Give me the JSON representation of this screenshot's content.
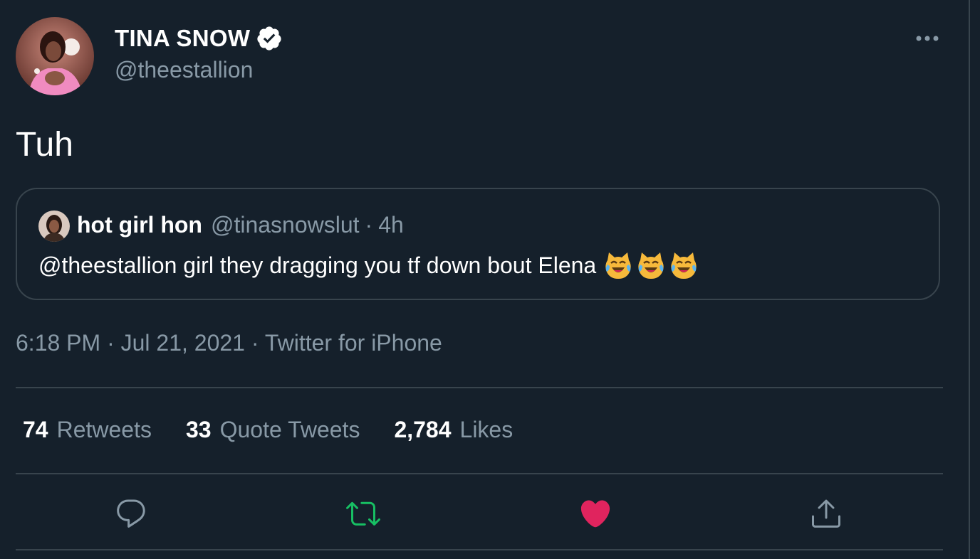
{
  "author": {
    "name": "TINA SNOW",
    "handle": "@theestallion",
    "verified": true
  },
  "tweet": {
    "text": "Tuh"
  },
  "quoted_tweet": {
    "name": "hot girl hon",
    "handle": "@tinasnowslut",
    "separator": "·",
    "time": "4h",
    "text": "@theestallion girl they dragging you tf down bout Elena",
    "emojis": [
      "cat-tears-of-joy-icon",
      "cat-tears-of-joy-icon",
      "cat-tears-of-joy-icon"
    ]
  },
  "meta": {
    "time": "6:18 PM",
    "sep1": " · ",
    "date": "Jul 21, 2021",
    "sep2": " · ",
    "source": "Twitter for iPhone"
  },
  "stats": {
    "retweets_count": "74",
    "retweets_label": "Retweets",
    "quote_count": "33",
    "quote_label": "Quote Tweets",
    "likes_count": "2,784",
    "likes_label": "Likes"
  },
  "actions": [
    "reply-icon",
    "retweet-icon",
    "like-icon",
    "share-icon"
  ],
  "colors": {
    "background": "#15202b",
    "border": "#38444d",
    "secondary_text": "#8899a6",
    "retweet_active": "#17bf63",
    "like_active": "#e0245e"
  }
}
